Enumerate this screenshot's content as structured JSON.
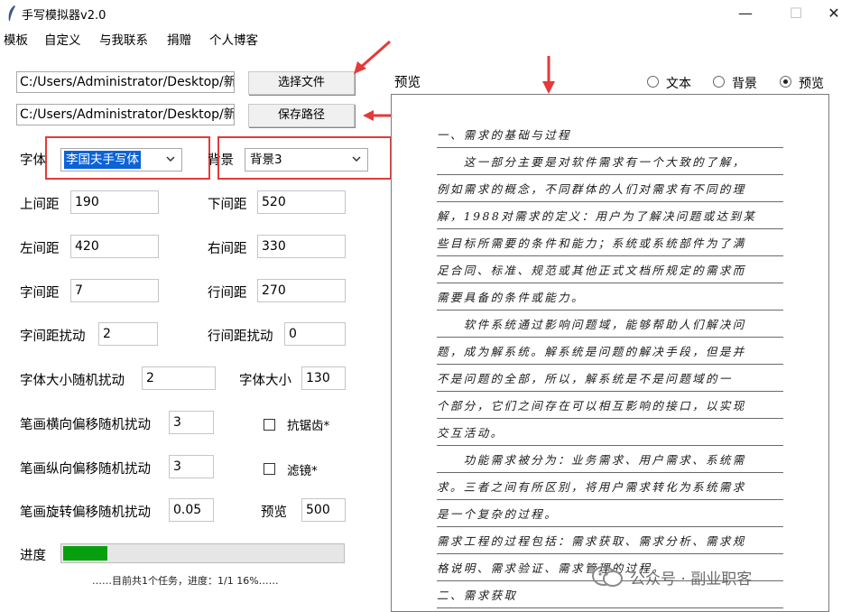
{
  "window": {
    "title": "手写模拟器v2.0",
    "minimize": "—",
    "maximize": "☐",
    "close": "✕"
  },
  "menu": [
    "模板",
    "自定义",
    "与我联系",
    "捐赠",
    "个人博客"
  ],
  "files": {
    "text_path": "C:/Users/Administrator/Desktop/新",
    "select_button": "选择文件",
    "save_path": "C:/Users/Administrator/Desktop/新",
    "save_button": "保存路径"
  },
  "font": {
    "label": "字体",
    "value": "李国夫手写体"
  },
  "background": {
    "label": "背景",
    "value": "背景3"
  },
  "fields": {
    "top_margin": {
      "label": "上间距",
      "value": "190"
    },
    "bottom_margin": {
      "label": "下间距",
      "value": "520"
    },
    "left_margin": {
      "label": "左间距",
      "value": "420"
    },
    "right_margin": {
      "label": "右间距",
      "value": "330"
    },
    "char_spacing": {
      "label": "字间距",
      "value": "7"
    },
    "line_spacing": {
      "label": "行间距",
      "value": "270"
    },
    "char_spacing_jitter": {
      "label": "字间距扰动",
      "value": "2"
    },
    "line_spacing_jitter": {
      "label": "行间距扰动",
      "value": "0"
    },
    "font_size_jitter": {
      "label": "字体大小随机扰动",
      "value": "2"
    },
    "font_size": {
      "label": "字体大小",
      "value": "130"
    },
    "stroke_h_jitter": {
      "label": "笔画横向偏移随机扰动",
      "value": "3"
    },
    "stroke_v_jitter": {
      "label": "笔画纵向偏移随机扰动",
      "value": "3"
    },
    "stroke_rot_jitter": {
      "label": "笔画旋转偏移随机扰动",
      "value": "0.05"
    },
    "preview_size": {
      "label": "预览",
      "value": "500"
    }
  },
  "checkboxes": {
    "antialias": "抗锯齿*",
    "filter": "滤镜*"
  },
  "progress": {
    "label": "进度",
    "fraction": 0.16,
    "status": "……目前共1个任务，进度：1/1  16%……"
  },
  "preview": {
    "label": "预览",
    "modes": [
      "文本",
      "背景",
      "预览"
    ],
    "selected_mode": "预览",
    "lines": [
      "一、需求的基础与过程",
      "　　这一部分主要是对软件需求有一个大致的了解，",
      "例如需求的概念，不同群体的人们对需求有不同的理",
      "解，1988对需求的定义：用户为了解决问题或达到某",
      "些目标所需要的条件和能力；系统或系统部件为了满",
      "足合同、标准、规范或其他正式文档所规定的需求而",
      "需要具备的条件或能力。",
      "　　软件系统通过影响问题域，能够帮助人们解决问",
      "题，成为解系统。解系统是问题的解决手段，但是并",
      "不是问题的全部，所以，解系统是不是问题域的一",
      "个部分，它们之间存在可以相互影响的接口，以实现",
      "交互活动。",
      "　　功能需求被分为：业务需求、用户需求、系统需",
      "求。三者之间有所区别，将用户需求转化为系统需求",
      "是一个复杂的过程。",
      "需求工程的过程包括：需求获取、需求分析、需求规",
      "格说明、需求验证、需求管理的过程。",
      "二、需求获取"
    ]
  },
  "watermark": "公众号 · 副业职客",
  "colors": {
    "annotation": "#e33a3a",
    "progress": "#06a00e",
    "selection": "#0b63d6"
  }
}
